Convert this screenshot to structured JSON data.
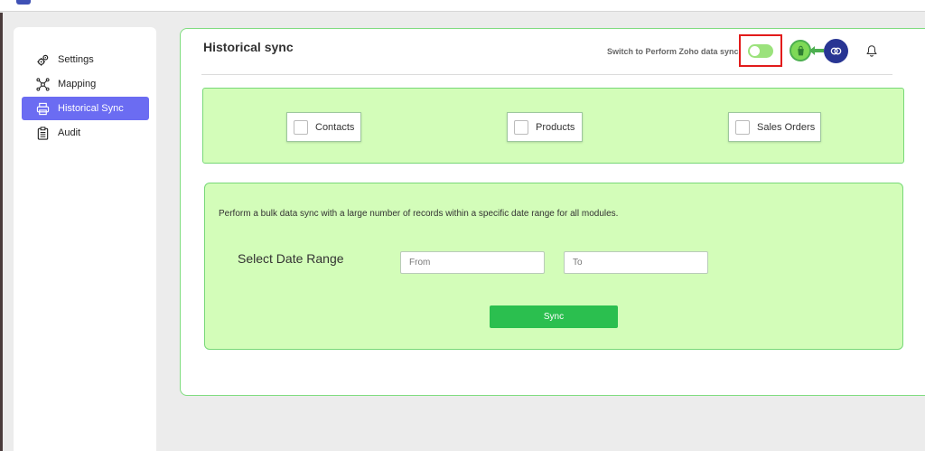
{
  "sidebar": {
    "items": [
      {
        "label": "Settings",
        "icon": "gear-icon",
        "active": false
      },
      {
        "label": "Mapping",
        "icon": "mapping-icon",
        "active": false
      },
      {
        "label": "Historical Sync",
        "icon": "printer-icon",
        "active": true
      },
      {
        "label": "Audit",
        "icon": "clipboard-icon",
        "active": false
      }
    ]
  },
  "header": {
    "title": "Historical sync",
    "switch_label": "Switch to Perform Zoho data sync",
    "toggle_on": true
  },
  "modules": [
    {
      "label": "Contacts",
      "checked": false
    },
    {
      "label": "Products",
      "checked": false
    },
    {
      "label": "Sales Orders",
      "checked": false
    }
  ],
  "sync": {
    "description": "Perform a bulk data sync with a large number of records within a specific date range for all modules.",
    "date_range_label": "Select Date Range",
    "from_placeholder": "From",
    "to_placeholder": "To",
    "button_label": "Sync"
  },
  "colors": {
    "accent": "#6b6cf2",
    "panel": "#d3fdb9",
    "border": "#78d878",
    "sync_button": "#2bbf4f",
    "highlight": "#e21b1b"
  }
}
